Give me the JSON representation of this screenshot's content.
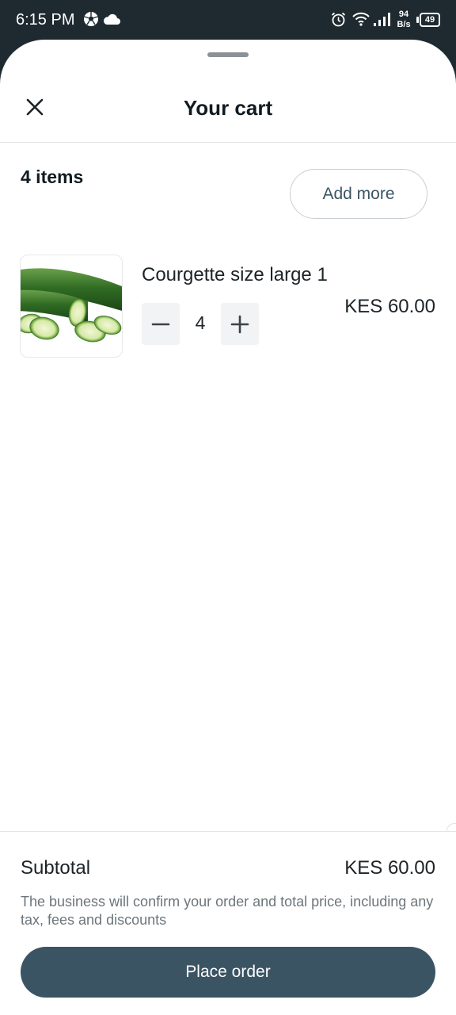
{
  "status_bar": {
    "time": "6:15 PM",
    "net_speed_value": "94",
    "net_speed_unit": "B/s",
    "battery": "49",
    "icons": [
      "soccer-ball-icon",
      "cloud-icon",
      "alarm-icon",
      "wifi-icon",
      "signal-icon",
      "battery-icon"
    ]
  },
  "header": {
    "title": "Your cart",
    "close_icon": "close-icon"
  },
  "cart": {
    "items_count_label": "4 items",
    "add_more_label": "Add more",
    "items": [
      {
        "name": "Courgette size large 1",
        "quantity": "4",
        "price": "KES 60.00",
        "image": "courgette-image"
      }
    ]
  },
  "footer": {
    "subtotal_label": "Subtotal",
    "subtotal_value": "KES 60.00",
    "note": "The business will confirm your order and total price, including any tax, fees and discounts",
    "place_order_label": "Place order"
  },
  "colors": {
    "primary_button": "#3b5464",
    "status_bar_bg": "#1f2a30",
    "add_more_text": "#3a5563"
  }
}
